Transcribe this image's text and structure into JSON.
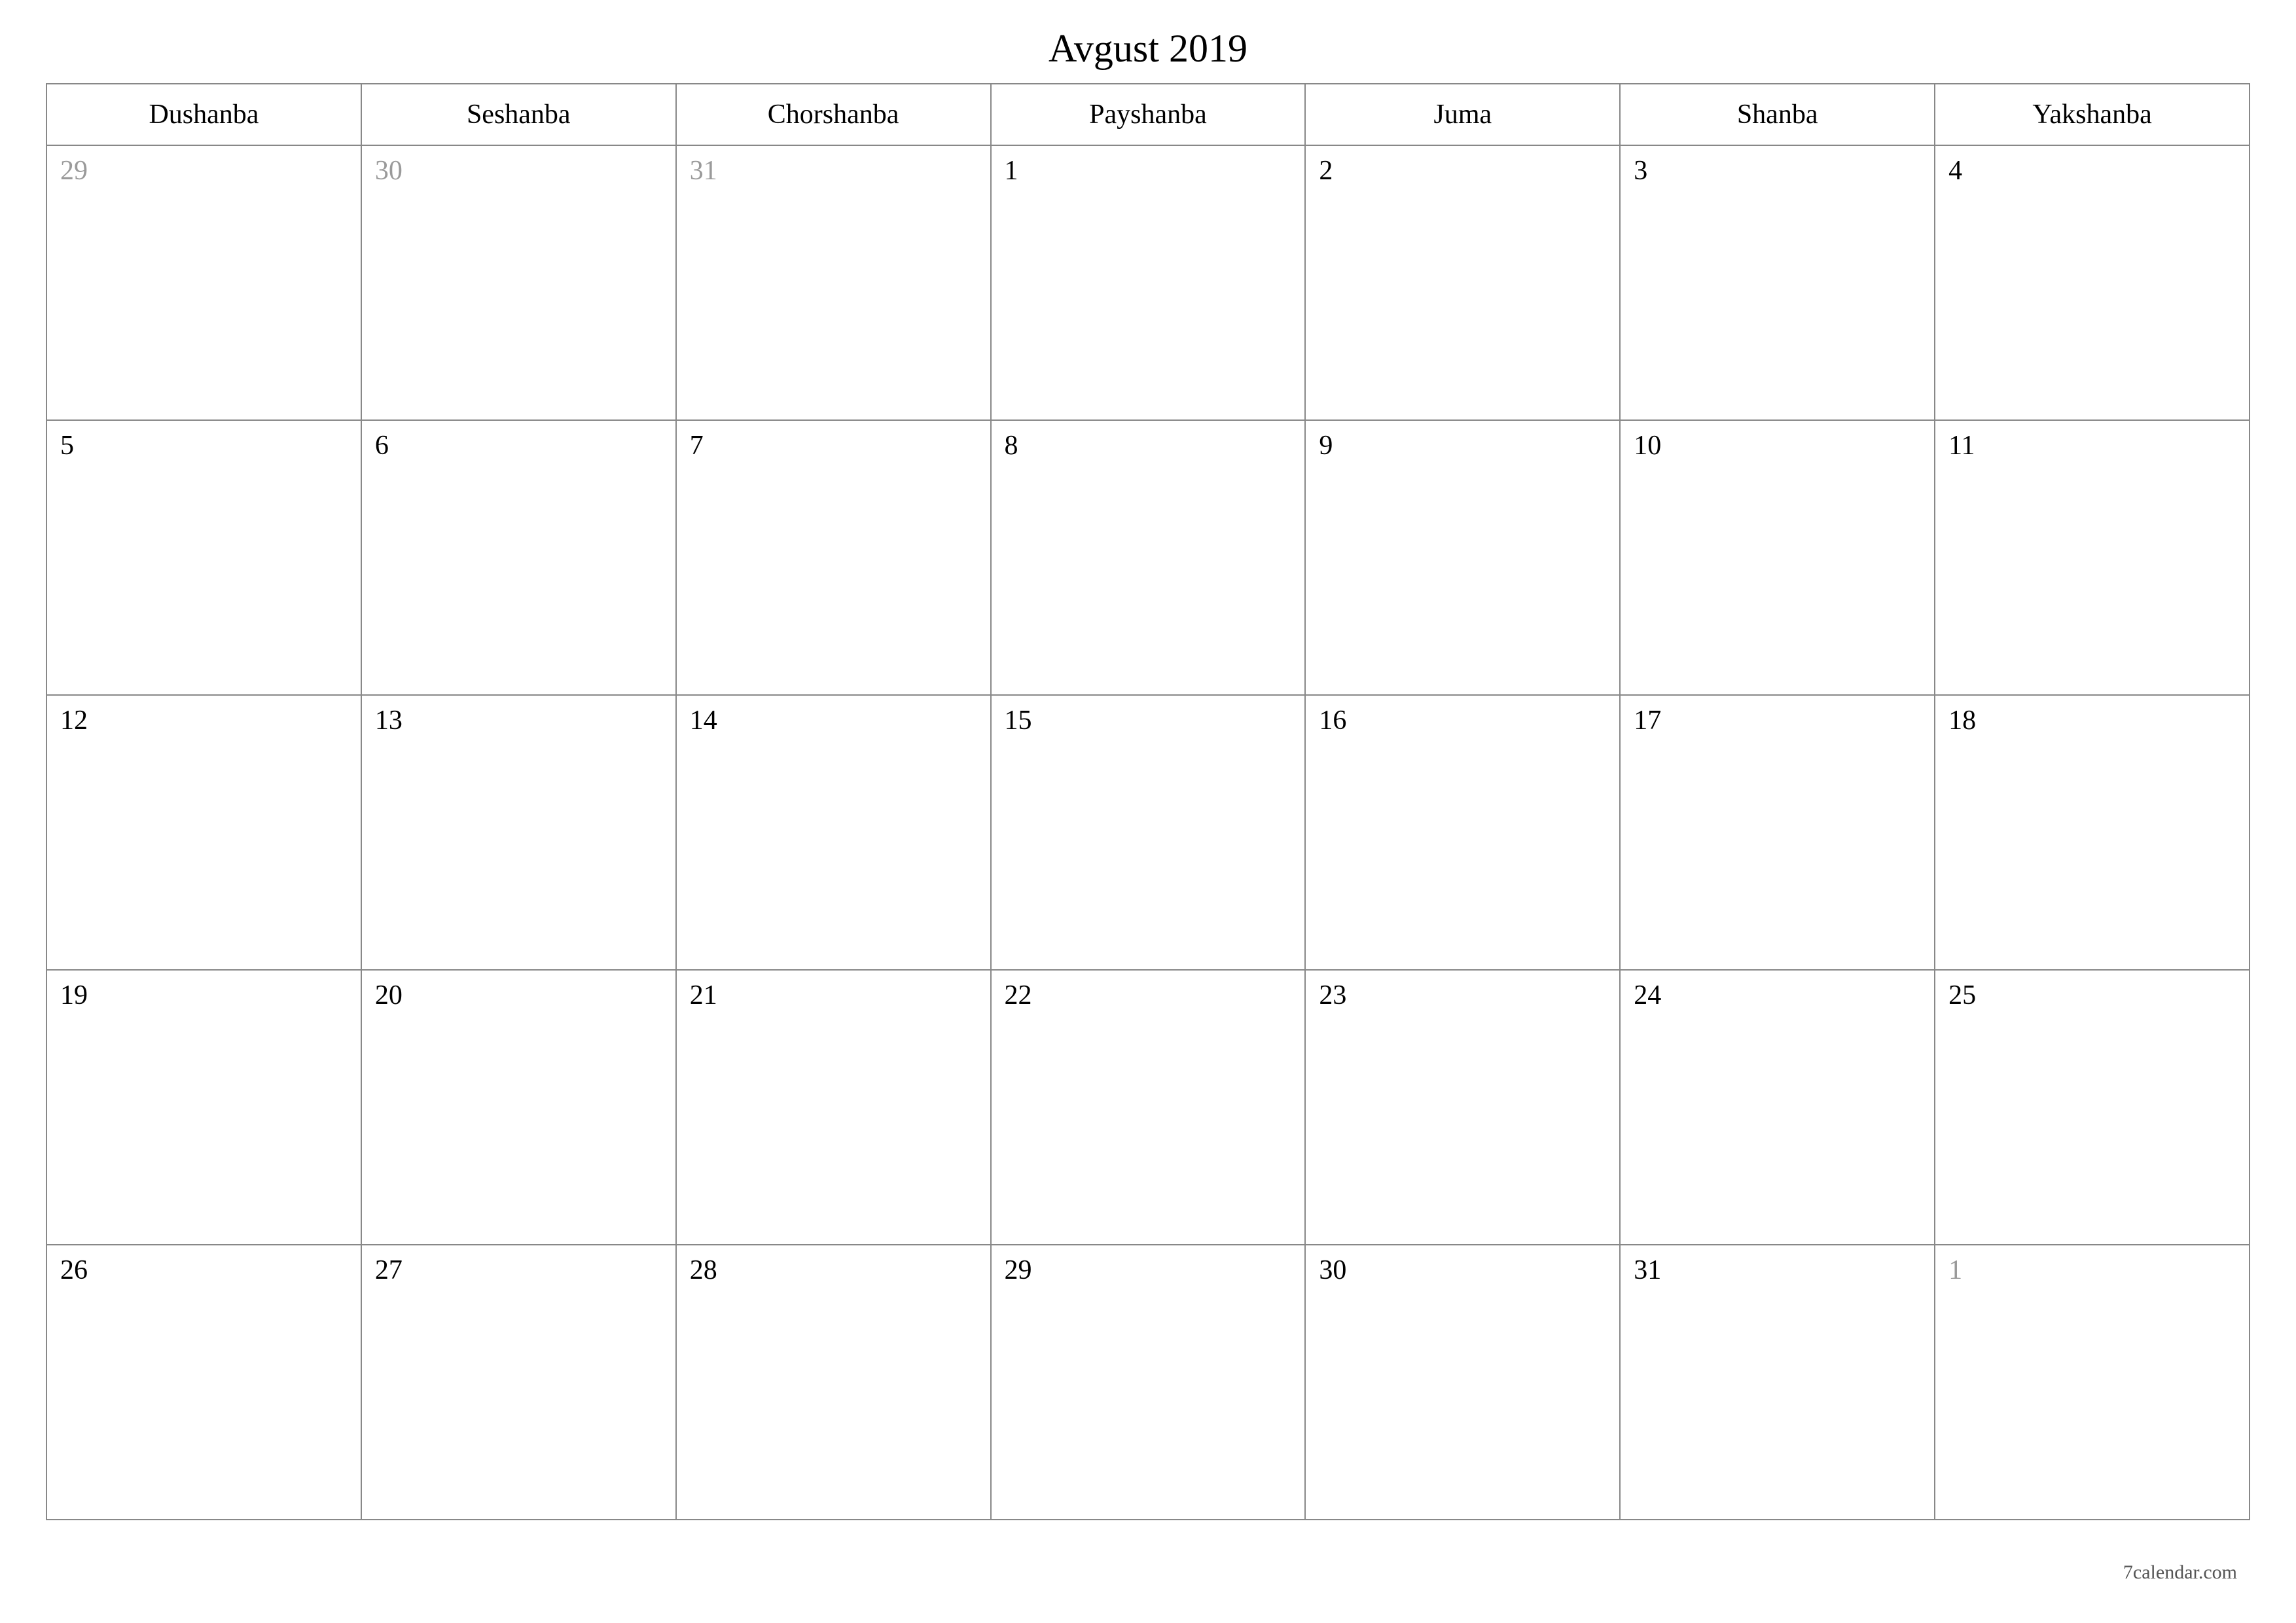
{
  "title": "Avgust 2019",
  "weekdays": [
    "Dushanba",
    "Seshanba",
    "Chorshanba",
    "Payshanba",
    "Juma",
    "Shanba",
    "Yakshanba"
  ],
  "weeks": [
    [
      {
        "day": "29",
        "other": true
      },
      {
        "day": "30",
        "other": true
      },
      {
        "day": "31",
        "other": true
      },
      {
        "day": "1",
        "other": false
      },
      {
        "day": "2",
        "other": false
      },
      {
        "day": "3",
        "other": false
      },
      {
        "day": "4",
        "other": false
      }
    ],
    [
      {
        "day": "5",
        "other": false
      },
      {
        "day": "6",
        "other": false
      },
      {
        "day": "7",
        "other": false
      },
      {
        "day": "8",
        "other": false
      },
      {
        "day": "9",
        "other": false
      },
      {
        "day": "10",
        "other": false
      },
      {
        "day": "11",
        "other": false
      }
    ],
    [
      {
        "day": "12",
        "other": false
      },
      {
        "day": "13",
        "other": false
      },
      {
        "day": "14",
        "other": false
      },
      {
        "day": "15",
        "other": false
      },
      {
        "day": "16",
        "other": false
      },
      {
        "day": "17",
        "other": false
      },
      {
        "day": "18",
        "other": false
      }
    ],
    [
      {
        "day": "19",
        "other": false
      },
      {
        "day": "20",
        "other": false
      },
      {
        "day": "21",
        "other": false
      },
      {
        "day": "22",
        "other": false
      },
      {
        "day": "23",
        "other": false
      },
      {
        "day": "24",
        "other": false
      },
      {
        "day": "25",
        "other": false
      }
    ],
    [
      {
        "day": "26",
        "other": false
      },
      {
        "day": "27",
        "other": false
      },
      {
        "day": "28",
        "other": false
      },
      {
        "day": "29",
        "other": false
      },
      {
        "day": "30",
        "other": false
      },
      {
        "day": "31",
        "other": false
      },
      {
        "day": "1",
        "other": true
      }
    ]
  ],
  "footer": "7calendar.com"
}
